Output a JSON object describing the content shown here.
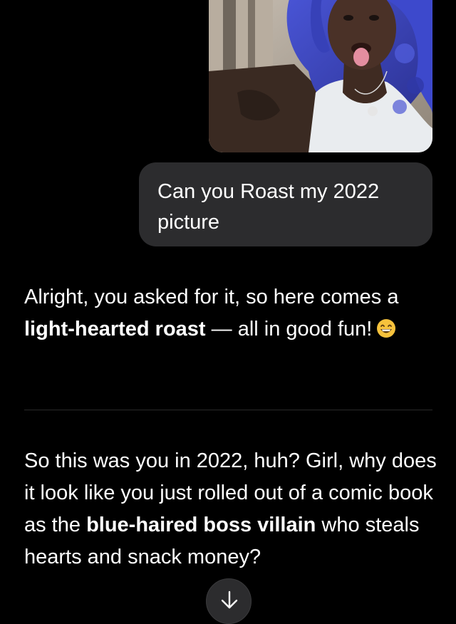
{
  "chat": {
    "user_image": {
      "description_icon": "user-photo"
    },
    "user_message": "Can you Roast my 2022 picture",
    "reply": {
      "p1_before": "Alright, you asked for it, so here comes a ",
      "p1_bold": "light-hearted roast",
      "p1_after": " — all in good fun!",
      "p1_emoji": "grinning-face-icon",
      "p2_before": "So this was you in 2022, huh? Girl, why does it look like you just rolled out of a comic book as the ",
      "p2_bold": "blue-haired boss villain",
      "p2_after": " who steals hearts and snack money?"
    }
  },
  "controls": {
    "scroll_down_icon": "arrow-down-icon"
  },
  "colors": {
    "background": "#000000",
    "bubble": "#2c2c2e",
    "hair": "#3b46c4",
    "emoji": "#f6c23c"
  }
}
